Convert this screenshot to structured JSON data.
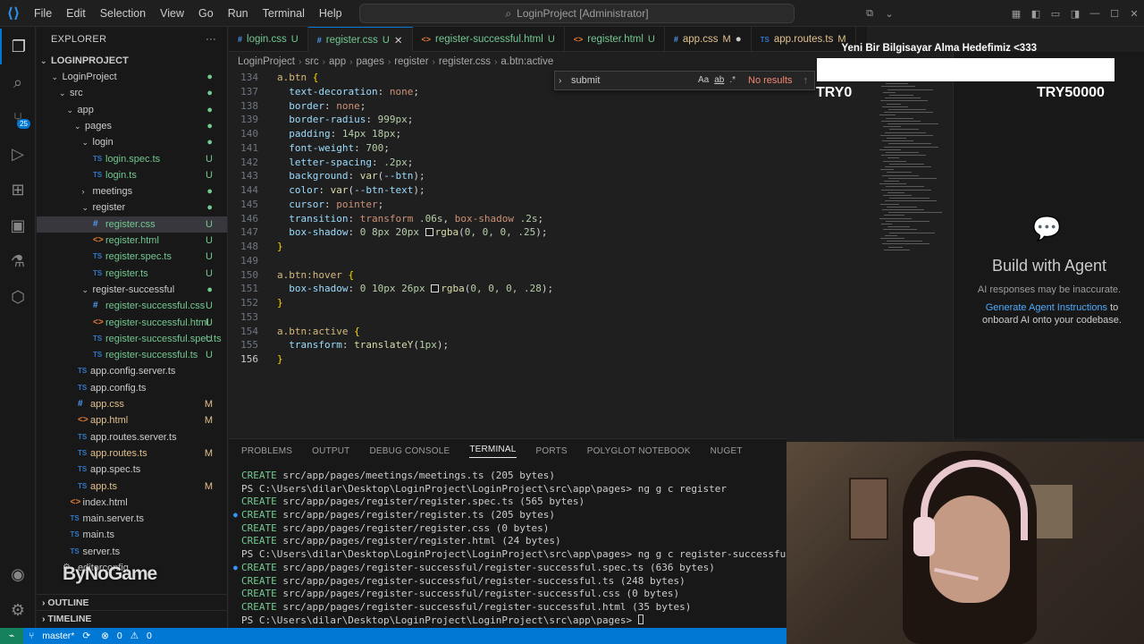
{
  "titlebar": {
    "menu": [
      "File",
      "Edit",
      "Selection",
      "View",
      "Go",
      "Run",
      "Terminal",
      "Help"
    ],
    "search_text": "LoginProject [Administrator]"
  },
  "sidebar": {
    "title": "EXPLORER",
    "root": "LOGINPROJECT",
    "items": [
      {
        "label": "LoginProject",
        "depth": 1,
        "chevron": "v",
        "icon": "",
        "status": "dot"
      },
      {
        "label": "src",
        "depth": 2,
        "chevron": "v",
        "icon": "",
        "status": "dot"
      },
      {
        "label": "app",
        "depth": 3,
        "chevron": "v",
        "icon": "",
        "status": "dot"
      },
      {
        "label": "pages",
        "depth": 4,
        "chevron": "v",
        "icon": "",
        "status": "dot"
      },
      {
        "label": "login",
        "depth": 5,
        "chevron": "v",
        "icon": "",
        "status": "dot"
      },
      {
        "label": "login.spec.ts",
        "depth": 6,
        "chevron": "",
        "icon": "ts",
        "status": "U"
      },
      {
        "label": "login.ts",
        "depth": 6,
        "chevron": "",
        "icon": "ts",
        "status": "U"
      },
      {
        "label": "meetings",
        "depth": 5,
        "chevron": ">",
        "icon": "",
        "status": "dot"
      },
      {
        "label": "register",
        "depth": 5,
        "chevron": "v",
        "icon": "",
        "status": "dot"
      },
      {
        "label": "register.css",
        "depth": 6,
        "chevron": "",
        "icon": "css",
        "status": "U",
        "selected": true
      },
      {
        "label": "register.html",
        "depth": 6,
        "chevron": "",
        "icon": "html",
        "status": "U"
      },
      {
        "label": "register.spec.ts",
        "depth": 6,
        "chevron": "",
        "icon": "ts",
        "status": "U"
      },
      {
        "label": "register.ts",
        "depth": 6,
        "chevron": "",
        "icon": "ts",
        "status": "U"
      },
      {
        "label": "register-successful",
        "depth": 5,
        "chevron": "v",
        "icon": "",
        "status": "dot"
      },
      {
        "label": "register-successful.css",
        "depth": 6,
        "chevron": "",
        "icon": "css",
        "status": "U"
      },
      {
        "label": "register-successful.html",
        "depth": 6,
        "chevron": "",
        "icon": "html",
        "status": "U"
      },
      {
        "label": "register-successful.spec.ts",
        "depth": 6,
        "chevron": "",
        "icon": "ts",
        "status": "U"
      },
      {
        "label": "register-successful.ts",
        "depth": 6,
        "chevron": "",
        "icon": "ts",
        "status": "U"
      },
      {
        "label": "app.config.server.ts",
        "depth": 4,
        "chevron": "",
        "icon": "ts",
        "status": ""
      },
      {
        "label": "app.config.ts",
        "depth": 4,
        "chevron": "",
        "icon": "ts",
        "status": ""
      },
      {
        "label": "app.css",
        "depth": 4,
        "chevron": "",
        "icon": "css",
        "status": "M"
      },
      {
        "label": "app.html",
        "depth": 4,
        "chevron": "",
        "icon": "html",
        "status": "M"
      },
      {
        "label": "app.routes.server.ts",
        "depth": 4,
        "chevron": "",
        "icon": "ts",
        "status": ""
      },
      {
        "label": "app.routes.ts",
        "depth": 4,
        "chevron": "",
        "icon": "ts",
        "status": "M"
      },
      {
        "label": "app.spec.ts",
        "depth": 4,
        "chevron": "",
        "icon": "ts",
        "status": ""
      },
      {
        "label": "app.ts",
        "depth": 4,
        "chevron": "",
        "icon": "ts",
        "status": "M"
      },
      {
        "label": "index.html",
        "depth": 3,
        "chevron": "",
        "icon": "html",
        "status": ""
      },
      {
        "label": "main.server.ts",
        "depth": 3,
        "chevron": "",
        "icon": "ts",
        "status": ""
      },
      {
        "label": "main.ts",
        "depth": 3,
        "chevron": "",
        "icon": "ts",
        "status": ""
      },
      {
        "label": "server.ts",
        "depth": 3,
        "chevron": "",
        "icon": "ts",
        "status": ""
      },
      {
        "label": ".editorconfig",
        "depth": 2,
        "chevron": "",
        "icon": "gear",
        "status": ""
      }
    ],
    "outline": "OUTLINE",
    "timeline": "TIMELINE"
  },
  "tabs": [
    {
      "label": "login.css",
      "icon": "css",
      "status": "U",
      "active": false
    },
    {
      "label": "register.css",
      "icon": "css",
      "status": "U",
      "active": true
    },
    {
      "label": "register-successful.html",
      "icon": "html",
      "status": "U",
      "active": false
    },
    {
      "label": "register.html",
      "icon": "html",
      "status": "U",
      "active": false
    },
    {
      "label": "app.css",
      "icon": "css",
      "status": "M",
      "active": false,
      "dirty": true
    },
    {
      "label": "app.routes.ts",
      "icon": "ts",
      "status": "M",
      "active": false
    }
  ],
  "breadcrumb": [
    "LoginProject",
    "src",
    "app",
    "pages",
    "register",
    "register.css",
    "a.btn:active"
  ],
  "find": {
    "query": "submit",
    "result": "No results",
    "opt_case": "Aa",
    "opt_word": "ab",
    "opt_regex": ".*"
  },
  "editor": {
    "current_line": 156,
    "lines": [
      {
        "n": 134,
        "html": "<span class='sel-k'>a.btn</span> <span class='brace'>{</span>"
      },
      {
        "n": 137,
        "html": "  <span class='prop'>text-decoration</span>: <span class='val'>none</span>;"
      },
      {
        "n": 138,
        "html": "  <span class='prop'>border</span>: <span class='val'>none</span>;"
      },
      {
        "n": 139,
        "html": "  <span class='prop'>border-radius</span>: <span class='num'>999px</span>;"
      },
      {
        "n": 140,
        "html": "  <span class='prop'>padding</span>: <span class='num'>14px 18px</span>;"
      },
      {
        "n": 141,
        "html": "  <span class='prop'>font-weight</span>: <span class='num'>700</span>;"
      },
      {
        "n": 142,
        "html": "  <span class='prop'>letter-spacing</span>: <span class='num'>.2px</span>;"
      },
      {
        "n": 143,
        "html": "  <span class='prop'>background</span>: <span class='fn'>var</span>(<span class='var'>--btn</span>);"
      },
      {
        "n": 144,
        "html": "  <span class='prop'>color</span>: <span class='fn'>var</span>(<span class='var'>--btn-text</span>);"
      },
      {
        "n": 145,
        "html": "  <span class='prop'>cursor</span>: <span class='val'>pointer</span>;"
      },
      {
        "n": 146,
        "html": "  <span class='prop'>transition</span>: <span class='val'>transform</span> <span class='num'>.06s</span>, <span class='val'>box-shadow</span> <span class='num'>.2s</span>;"
      },
      {
        "n": 147,
        "html": "  <span class='prop'>box-shadow</span>: <span class='num'>0 8px 20px</span> <span class='swatch' style='background:rgba(0,0,0,.25)'></span><span class='fn'>rgba</span>(<span class='num'>0, 0, 0, .25</span>);"
      },
      {
        "n": 148,
        "html": "<span class='brace'>}</span>"
      },
      {
        "n": 149,
        "html": ""
      },
      {
        "n": 150,
        "html": "<span class='sel-k'>a.btn:hover</span> <span class='brace'>{</span>"
      },
      {
        "n": 151,
        "html": "  <span class='prop'>box-shadow</span>: <span class='num'>0 10px 26px</span> <span class='swatch' style='background:rgba(0,0,0,.28)'></span><span class='fn'>rgba</span>(<span class='num'>0, 0, 0, .28</span>);"
      },
      {
        "n": 152,
        "html": "<span class='brace'>}</span>"
      },
      {
        "n": 153,
        "html": ""
      },
      {
        "n": 154,
        "html": "<span class='sel-k'>a.btn:active</span> <span class='brace'>{</span>"
      },
      {
        "n": 155,
        "html": "  <span class='prop'>transform</span>: <span class='fn'>translateY</span>(<span class='num'>1px</span>);"
      },
      {
        "n": 156,
        "html": "<span class='brace'>}</span>"
      }
    ]
  },
  "panel": {
    "tabs": [
      "PROBLEMS",
      "OUTPUT",
      "DEBUG CONSOLE",
      "TERMINAL",
      "PORTS",
      "POLYGLOT NOTEBOOK",
      "NUGET"
    ],
    "active_tab": "TERMINAL",
    "terminal": [
      {
        "kind": "create",
        "text": " src/app/pages/meetings/meetings.ts (205 bytes)",
        "dot": false
      },
      {
        "kind": "prompt",
        "text": "PS C:\\Users\\dilar\\Desktop\\LoginProject\\LoginProject\\src\\app\\pages> ng g c register",
        "dot": false
      },
      {
        "kind": "create",
        "text": " src/app/pages/register/register.spec.ts (565 bytes)",
        "dot": false
      },
      {
        "kind": "create",
        "text": " src/app/pages/register/register.ts (205 bytes)",
        "dot": true
      },
      {
        "kind": "create",
        "text": " src/app/pages/register/register.css (0 bytes)",
        "dot": false
      },
      {
        "kind": "create",
        "text": " src/app/pages/register/register.html (24 bytes)",
        "dot": false
      },
      {
        "kind": "prompt",
        "text": "PS C:\\Users\\dilar\\Desktop\\LoginProject\\LoginProject\\src\\app\\pages> ng g c register-successful",
        "dot": false
      },
      {
        "kind": "create",
        "text": " src/app/pages/register-successful/register-successful.spec.ts (636 bytes)",
        "dot": true
      },
      {
        "kind": "create",
        "text": " src/app/pages/register-successful/register-successful.ts (248 bytes)",
        "dot": false
      },
      {
        "kind": "create",
        "text": " src/app/pages/register-successful/register-successful.css (0 bytes)",
        "dot": false
      },
      {
        "kind": "create",
        "text": " src/app/pages/register-successful/register-successful.html (35 bytes)",
        "dot": false
      },
      {
        "kind": "prompt",
        "text": "PS C:\\Users\\dilar\\Desktop\\LoginProject\\LoginProject\\src\\app\\pages> ",
        "dot": false
      }
    ],
    "create_word": "CREATE"
  },
  "chat": {
    "title": "Build with Agent",
    "subtitle": "AI responses may be inaccurate.",
    "link": "Generate Agent Instructions",
    "hint_rest": " to onboard AI onto your codebase."
  },
  "overlay": {
    "goal_text": "Yeni Bir Bilgisayar Alma Hedefimiz <333",
    "goal_start": "TRY0",
    "goal_end": "TRY50000",
    "goal_progress": 0
  },
  "watermark": "ByNoGame",
  "statusbar": {
    "branch": "master*",
    "errors": "0",
    "warnings": "0"
  },
  "colors": {
    "accent": "#0078d4",
    "untracked": "#73c991",
    "modified": "#e2c08d"
  }
}
